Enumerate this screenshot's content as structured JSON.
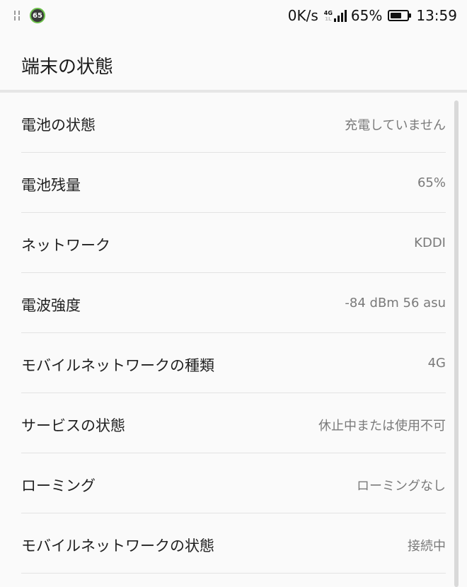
{
  "status_bar": {
    "notification_badge": "65",
    "net_speed": "0K/s",
    "network_type": "4G",
    "network_sub": "1L",
    "battery_percent": "65%",
    "battery_level": 0.65,
    "time": "13:59"
  },
  "header": {
    "title": "端末の状態"
  },
  "items": [
    {
      "label": "電池の状態",
      "value": "充電していません"
    },
    {
      "label": "電池残量",
      "value": "65%"
    },
    {
      "label": "ネットワーク",
      "value": "KDDI"
    },
    {
      "label": "電波強度",
      "value": "-84 dBm   56 asu"
    },
    {
      "label": "モバイルネットワークの種類",
      "value": "4G"
    },
    {
      "label": "サービスの状態",
      "value": "休止中または使用不可"
    },
    {
      "label": "ローミング",
      "value": "ローミングなし"
    },
    {
      "label": "モバイルネットワークの状態",
      "value": "接続中"
    }
  ],
  "colors": {
    "background": "#fafafa",
    "text_primary": "#212121",
    "text_secondary": "#7a7a7a",
    "divider": "#e3e3e3",
    "badge_ring": "#6cc04a"
  }
}
